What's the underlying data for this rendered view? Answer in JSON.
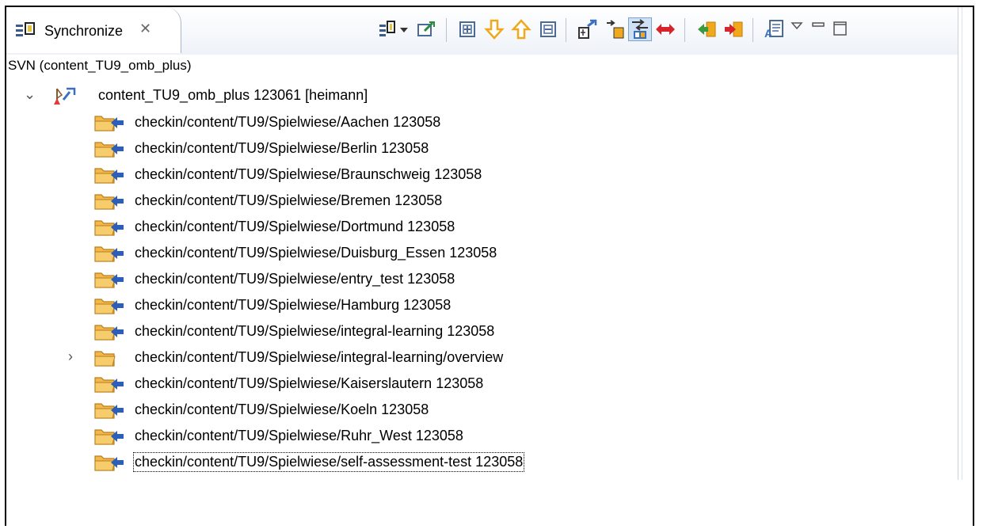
{
  "view": {
    "tab_title": "Synchronize",
    "tab_close": "✕"
  },
  "toolbar_icons": [
    "synchronize-dropdown-icon",
    "pin-icon",
    "expand-all-icon",
    "next-change-icon",
    "previous-change-icon",
    "collapse-all-icon",
    "incoming-mode-icon",
    "outgoing-mode-icon",
    "incoming-outgoing-mode-icon",
    "conflicts-mode-icon",
    "update-icon",
    "commit-icon",
    "compare-editor-icon",
    "view-menu-icon",
    "minimize-icon",
    "maximize-icon"
  ],
  "tree": {
    "root_label": "SVN (content_TU9_omb_plus)",
    "project_label": "content_TU9_omb_plus 123061 [heimann]",
    "items": [
      {
        "label": "checkin/content/TU9/Spielwiese/Aachen 123058"
      },
      {
        "label": "checkin/content/TU9/Spielwiese/Berlin 123058"
      },
      {
        "label": "checkin/content/TU9/Spielwiese/Braunschweig 123058"
      },
      {
        "label": "checkin/content/TU9/Spielwiese/Bremen 123058"
      },
      {
        "label": "checkin/content/TU9/Spielwiese/Dortmund 123058"
      },
      {
        "label": "checkin/content/TU9/Spielwiese/Duisburg_Essen 123058"
      },
      {
        "label": "checkin/content/TU9/Spielwiese/entry_test 123058"
      },
      {
        "label": "checkin/content/TU9/Spielwiese/Hamburg 123058"
      },
      {
        "label": "checkin/content/TU9/Spielwiese/integral-learning 123058"
      },
      {
        "label": "checkin/content/TU9/Spielwiese/integral-learning/overview"
      },
      {
        "label": "checkin/content/TU9/Spielwiese/Kaiserslautern 123058"
      },
      {
        "label": "checkin/content/TU9/Spielwiese/Koeln 123058"
      },
      {
        "label": "checkin/content/TU9/Spielwiese/Ruhr_West 123058"
      },
      {
        "label": "checkin/content/TU9/Spielwiese/self-assessment-test 123058"
      }
    ]
  },
  "colors": {
    "folder": "#f2b84b",
    "incoming_arrow": "#2b5fb8",
    "toolbar_arrow": "#f0a81c"
  }
}
